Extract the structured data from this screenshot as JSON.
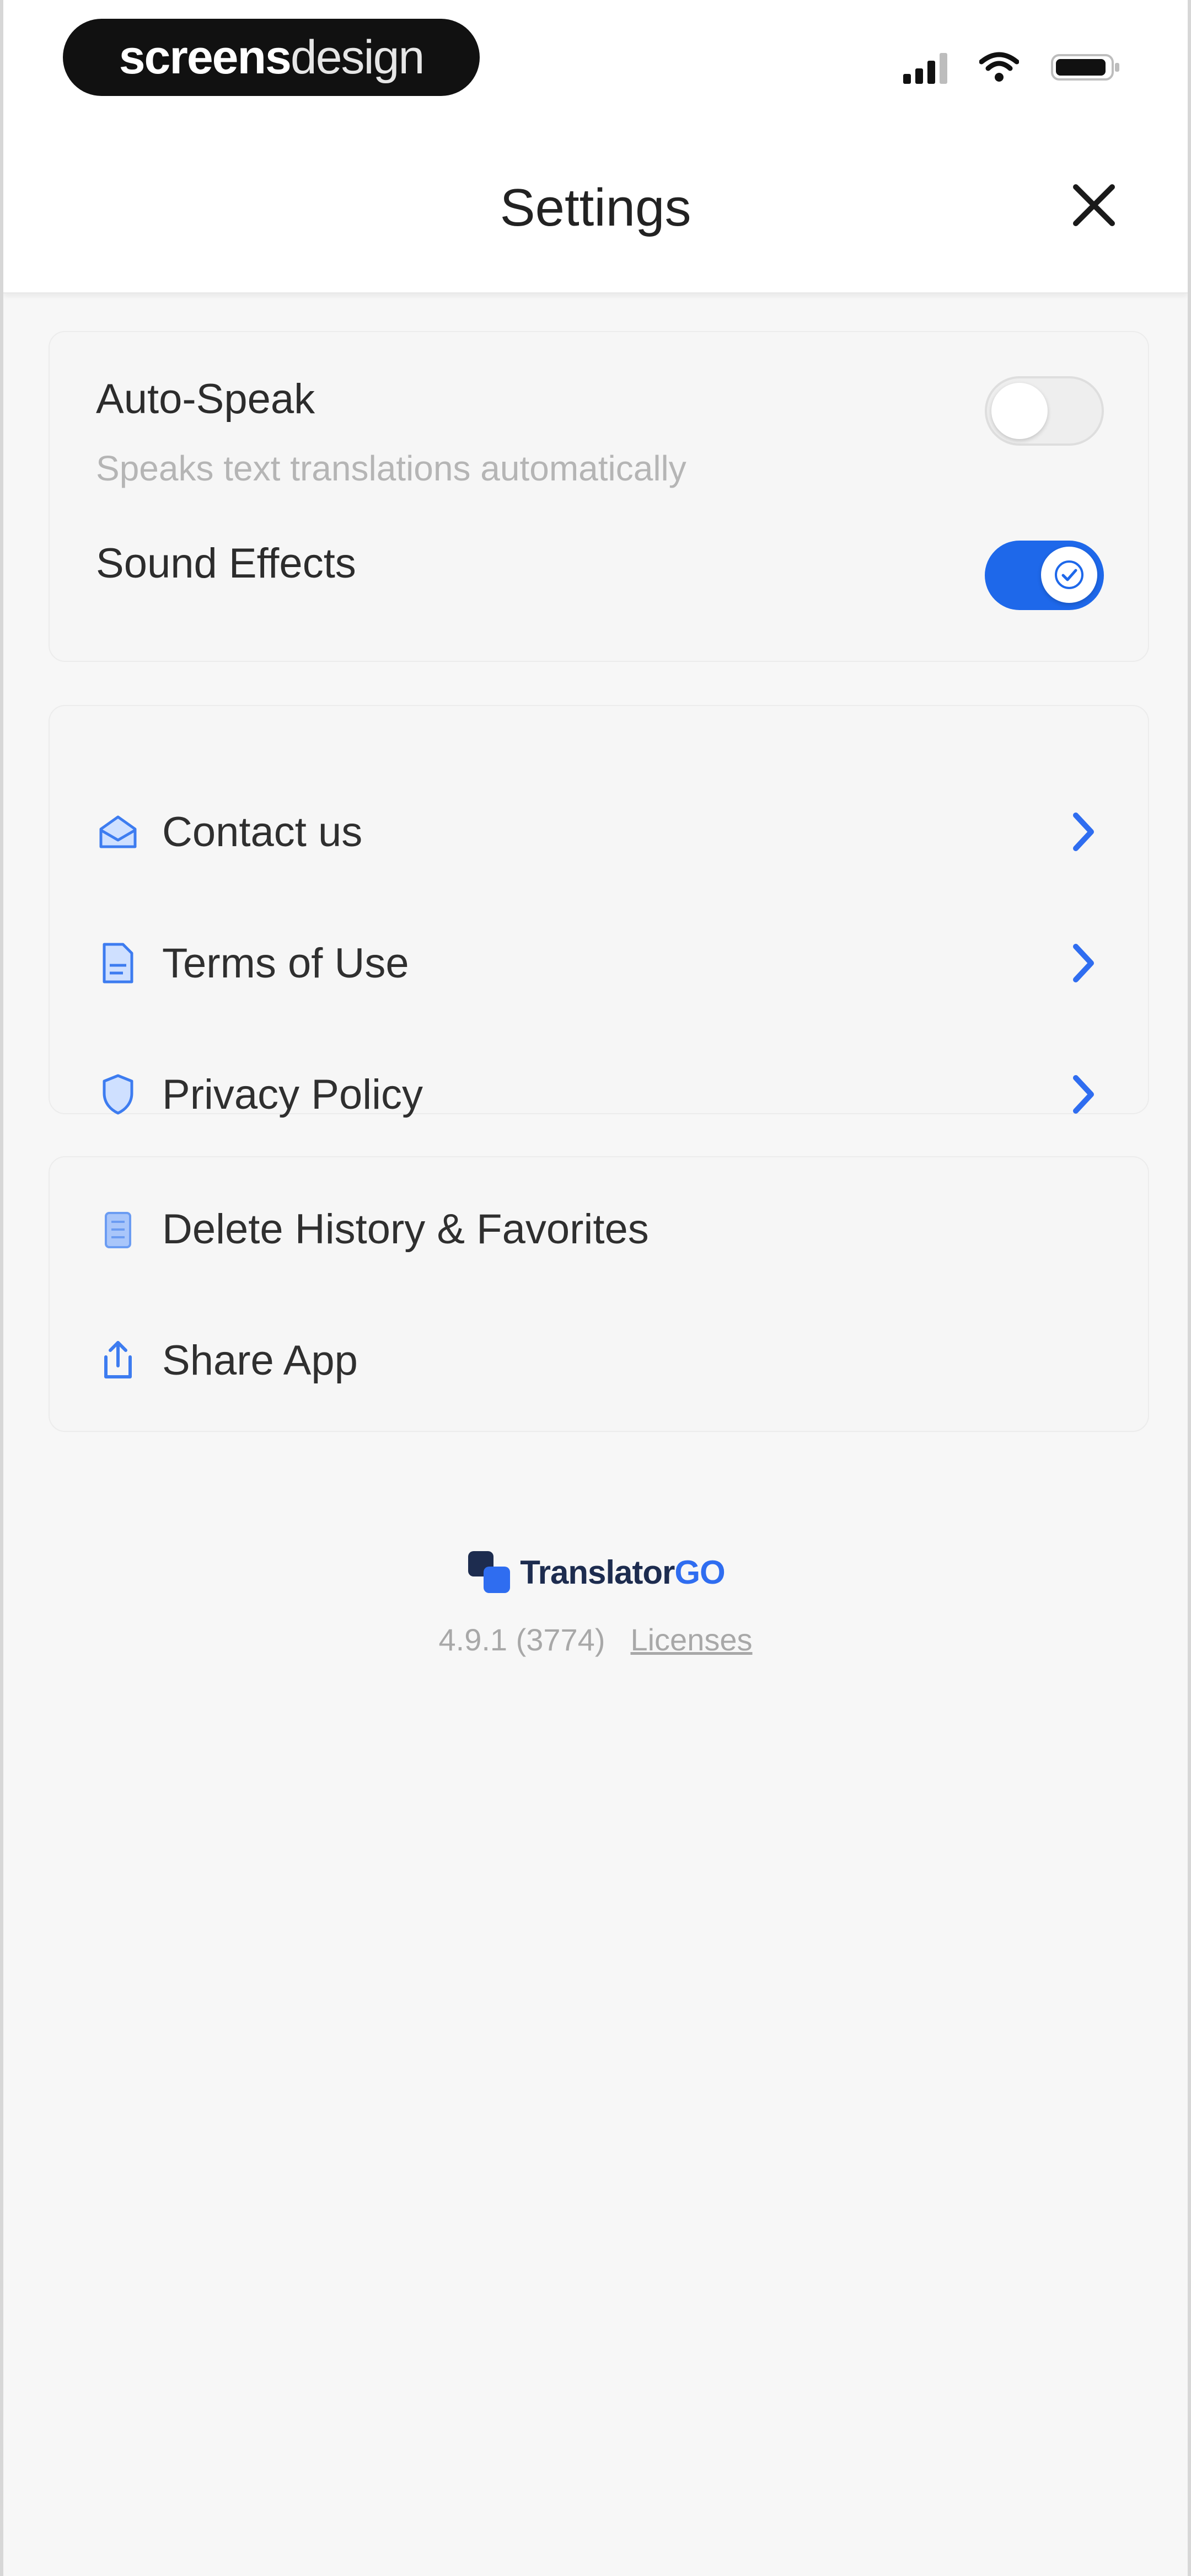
{
  "status_bar": {
    "brand_bold": "screens",
    "brand_light": "design",
    "icons": [
      "signal-icon",
      "wifi-icon",
      "battery-icon"
    ]
  },
  "header": {
    "title": "Settings",
    "close_icon": "close-icon"
  },
  "toggles": [
    {
      "title": "Auto-Speak",
      "subtitle": "Speaks text translations automatically",
      "state": "off"
    },
    {
      "title": "Sound Effects",
      "state": "on"
    }
  ],
  "links": [
    {
      "label": "Contact us",
      "icon": "mail-icon"
    },
    {
      "label": "Terms of Use",
      "icon": "document-icon"
    },
    {
      "label": "Privacy Policy",
      "icon": "shield-icon"
    }
  ],
  "actions": [
    {
      "label": "Delete History & Favorites",
      "icon": "trash-icon"
    },
    {
      "label": "Share App",
      "icon": "share-icon"
    }
  ],
  "footer": {
    "logo_text_main": "Translator",
    "logo_text_accent": "GO",
    "version": "4.9.1 (3774)",
    "licenses_label": "Licenses"
  },
  "colors": {
    "accent": "#1e68ea",
    "background": "#f7f7f7",
    "text": "#2c2c2c",
    "muted": "#b5b5b5"
  }
}
